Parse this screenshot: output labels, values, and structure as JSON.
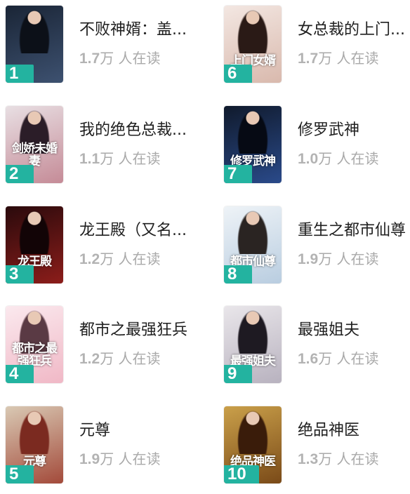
{
  "books": [
    {
      "rank": "1",
      "title": "不败神婿：盖...",
      "reads_num": "1.7",
      "reads_unit": "万 人在读",
      "cover_text": "",
      "cover_colors": [
        "#1a2536",
        "#3d5170"
      ],
      "figure_color": "#0c1018"
    },
    {
      "rank": "2",
      "title": "我的绝色总裁...",
      "reads_num": "1.1",
      "reads_unit": "万 人在读",
      "cover_text": "剑娇未婚妻",
      "cover_colors": [
        "#e8dfe3",
        "#c58b97"
      ],
      "figure_color": "#2b1d28"
    },
    {
      "rank": "3",
      "title": "龙王殿（又名...",
      "reads_num": "1.2",
      "reads_unit": "万 人在读",
      "cover_text": "龙王殿",
      "cover_colors": [
        "#2a0a0c",
        "#8c1d1a"
      ],
      "figure_color": "#120406"
    },
    {
      "rank": "4",
      "title": "都市之最强狂兵",
      "reads_num": "1.2",
      "reads_unit": "万 人在读",
      "cover_text": "都市之最强狂兵",
      "cover_colors": [
        "#fbe9ee",
        "#f0b8c6"
      ],
      "figure_color": "#5a3a44"
    },
    {
      "rank": "5",
      "title": "元尊",
      "reads_num": "1.9",
      "reads_unit": "万 人在读",
      "cover_text": "元尊",
      "cover_colors": [
        "#d9c9b4",
        "#a34a3a"
      ],
      "figure_color": "#7b2a20"
    },
    {
      "rank": "6",
      "title": "女总裁的上门...",
      "reads_num": "1.7",
      "reads_unit": "万 人在读",
      "cover_text": "上门女婿",
      "cover_colors": [
        "#f3e7e2",
        "#d9b9ad"
      ],
      "figure_color": "#2a1a16"
    },
    {
      "rank": "7",
      "title": "修罗武神",
      "reads_num": "1.0",
      "reads_unit": "万 人在读",
      "cover_text": "修罗武神",
      "cover_colors": [
        "#101a2c",
        "#2a4a8a"
      ],
      "figure_color": "#060a14"
    },
    {
      "rank": "8",
      "title": "重生之都市仙尊",
      "reads_num": "1.9",
      "reads_unit": "万 人在读",
      "cover_text": "都市仙尊",
      "cover_colors": [
        "#eef3f7",
        "#b9cde0"
      ],
      "figure_color": "#2a2422"
    },
    {
      "rank": "9",
      "title": "最强姐夫",
      "reads_num": "1.6",
      "reads_unit": "万 人在读",
      "cover_text": "最强姐夫",
      "cover_colors": [
        "#e9e6ea",
        "#b8b2bf"
      ],
      "figure_color": "#1e1a22"
    },
    {
      "rank": "10",
      "title": "绝品神医",
      "reads_num": "1.3",
      "reads_unit": "万 人在读",
      "cover_text": "绝品神医",
      "cover_colors": [
        "#caa04a",
        "#7a4a18"
      ],
      "figure_color": "#3a1c0a"
    }
  ]
}
